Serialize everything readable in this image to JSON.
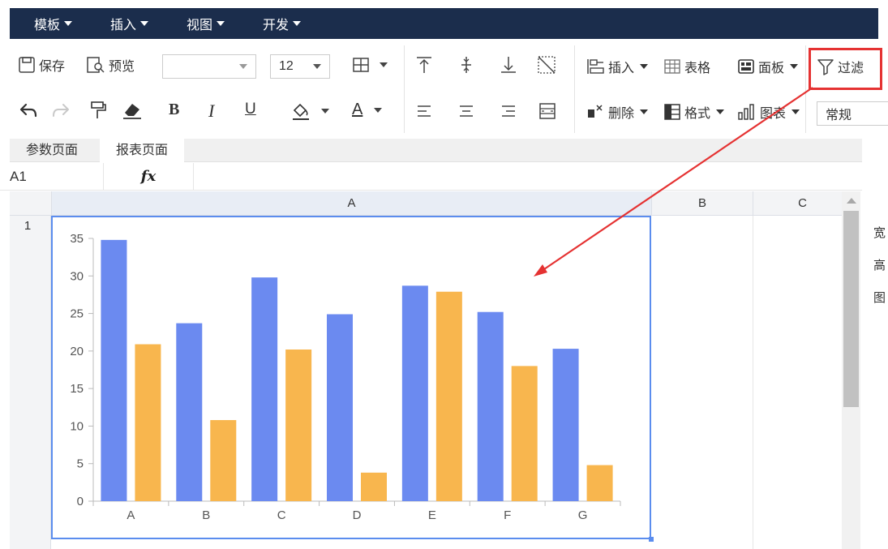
{
  "menu": {
    "items": [
      {
        "label": "模板"
      },
      {
        "label": "插入"
      },
      {
        "label": "视图"
      },
      {
        "label": "开发"
      }
    ]
  },
  "toolbar": {
    "save_label": "保存",
    "preview_label": "预览",
    "font_family_value": "",
    "font_size_value": "12",
    "insert_label": "插入",
    "delete_label": "删除",
    "table_label": "表格",
    "format_label": "格式",
    "panel_label": "面板",
    "chart_label": "图表",
    "filter_label": "过滤",
    "number_format_value": "常规"
  },
  "tabs": [
    {
      "label": "参数页面"
    },
    {
      "label": "报表页面"
    }
  ],
  "formula_bar": {
    "cell_ref": "A1",
    "fx_label": "fx",
    "value": ""
  },
  "sheet": {
    "columns": [
      "A",
      "B",
      "C"
    ],
    "rows": [
      "1"
    ]
  },
  "right_panel": {
    "chars": [
      "宽",
      "高",
      "图"
    ]
  },
  "colors": {
    "menu_bg": "#1b2d4c",
    "series_blue": "#6b8af0",
    "series_orange": "#f8b64e",
    "selection": "#5b8dee",
    "annotation_red": "#e53232"
  },
  "chart_data": {
    "type": "bar",
    "categories": [
      "A",
      "B",
      "C",
      "D",
      "E",
      "F",
      "G"
    ],
    "series": [
      {
        "values": [
          34.8,
          23.7,
          29.8,
          24.9,
          28.7,
          25.2,
          20.3
        ],
        "color": "#6b8af0"
      },
      {
        "values": [
          20.9,
          10.8,
          20.2,
          3.8,
          27.9,
          18.0,
          4.8
        ],
        "color": "#f8b64e"
      }
    ],
    "ylim": [
      0,
      35
    ],
    "yticks": [
      0,
      5,
      10,
      15,
      20,
      25,
      30,
      35
    ],
    "grid": false,
    "legend": "none"
  }
}
